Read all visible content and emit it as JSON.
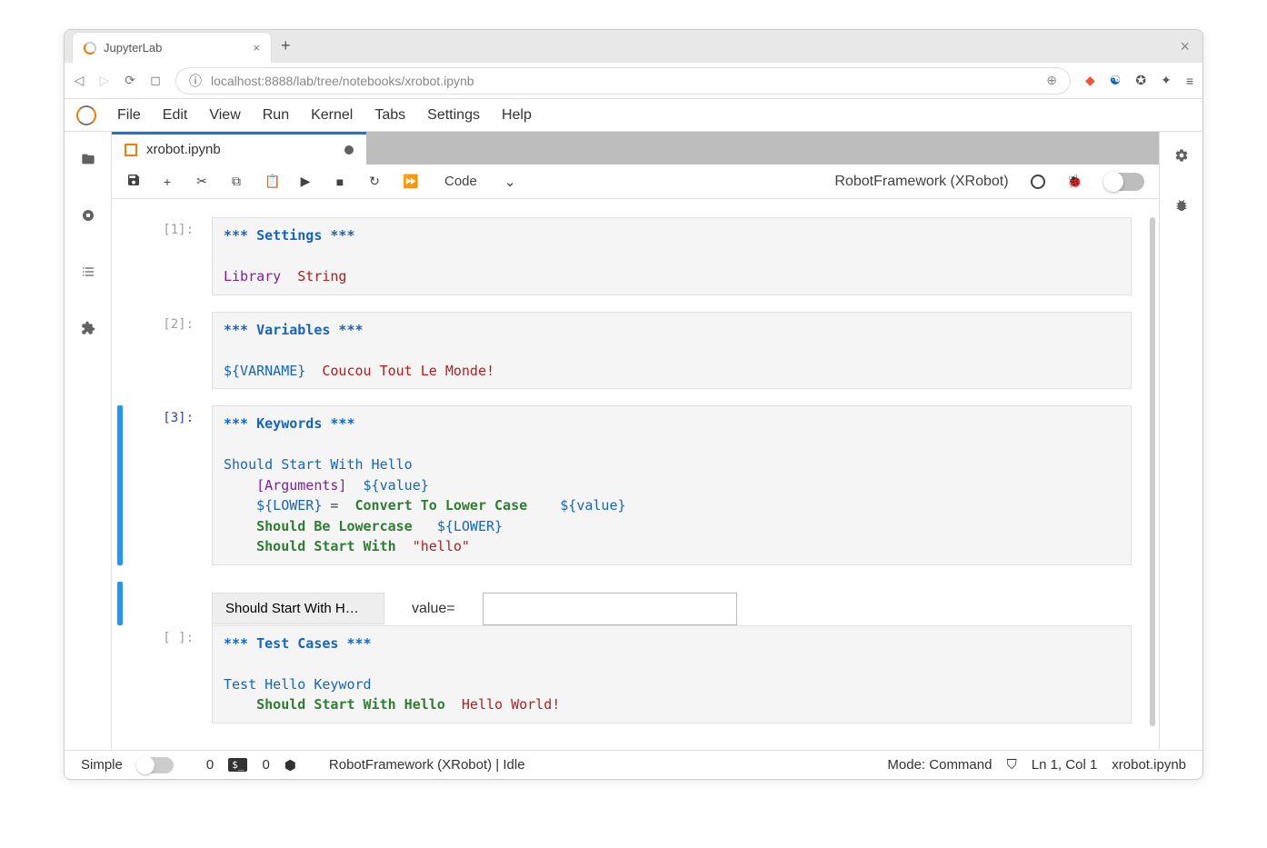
{
  "browser": {
    "tab_title": "JupyterLab",
    "url_host": "localhost:",
    "url_port": "8888",
    "url_path": "/lab/tree/notebooks/xrobot.ipynb"
  },
  "menu": [
    "File",
    "Edit",
    "View",
    "Run",
    "Kernel",
    "Tabs",
    "Settings",
    "Help"
  ],
  "doc_tab": {
    "title": "xrobot.ipynb"
  },
  "toolbar": {
    "celltype": "Code",
    "kernel": "RobotFramework (XRobot)"
  },
  "cells": [
    {
      "prompt": "[1]:",
      "selected": false,
      "lines": [
        [
          {
            "cls": "tok-section",
            "t": "*** "
          },
          {
            "cls": "tok-section",
            "t": "Settings"
          },
          {
            "cls": "tok-section",
            "t": " ***"
          }
        ],
        [
          {
            "cls": "",
            "t": ""
          }
        ],
        [
          {
            "cls": "tok-setting",
            "t": "Library"
          },
          {
            "cls": "",
            "t": "  "
          },
          {
            "cls": "tok-string",
            "t": "String"
          }
        ]
      ]
    },
    {
      "prompt": "[2]:",
      "selected": false,
      "lines": [
        [
          {
            "cls": "tok-section",
            "t": "*** "
          },
          {
            "cls": "tok-section",
            "t": "Variables"
          },
          {
            "cls": "tok-section",
            "t": " ***"
          }
        ],
        [
          {
            "cls": "",
            "t": ""
          }
        ],
        [
          {
            "cls": "tok-var",
            "t": "${VARNAME}"
          },
          {
            "cls": "",
            "t": "  "
          },
          {
            "cls": "tok-string",
            "t": "Coucou Tout Le Monde!"
          }
        ]
      ]
    },
    {
      "prompt": "[3]:",
      "selected": true,
      "lines": [
        [
          {
            "cls": "tok-section",
            "t": "*** "
          },
          {
            "cls": "tok-section",
            "t": "Keywords"
          },
          {
            "cls": "tok-section",
            "t": " ***"
          }
        ],
        [
          {
            "cls": "",
            "t": ""
          }
        ],
        [
          {
            "cls": "tok-keyword-def",
            "t": "Should Start With Hello"
          }
        ],
        [
          {
            "cls": "",
            "t": "    "
          },
          {
            "cls": "tok-arg",
            "t": "[Arguments]"
          },
          {
            "cls": "",
            "t": "  "
          },
          {
            "cls": "tok-var",
            "t": "${value}"
          }
        ],
        [
          {
            "cls": "",
            "t": "    "
          },
          {
            "cls": "tok-var",
            "t": "${LOWER}"
          },
          {
            "cls": "tok-assign",
            "t": " =  "
          },
          {
            "cls": "tok-kw-call",
            "t": "Convert To Lower Case"
          },
          {
            "cls": "",
            "t": "    "
          },
          {
            "cls": "tok-var",
            "t": "${value}"
          }
        ],
        [
          {
            "cls": "",
            "t": "    "
          },
          {
            "cls": "tok-kw-call",
            "t": "Should Be Lowercase"
          },
          {
            "cls": "",
            "t": "   "
          },
          {
            "cls": "tok-var",
            "t": "${LOWER}"
          }
        ],
        [
          {
            "cls": "",
            "t": "    "
          },
          {
            "cls": "tok-kw-call",
            "t": "Should Start With"
          },
          {
            "cls": "",
            "t": "  "
          },
          {
            "cls": "tok-quoted",
            "t": "\"hello\""
          }
        ]
      ],
      "output": {
        "button": "Should Start With H…",
        "label": "value="
      }
    },
    {
      "prompt": "[ ]:",
      "selected": false,
      "lines": [
        [
          {
            "cls": "tok-section",
            "t": "*** "
          },
          {
            "cls": "tok-section",
            "t": "Test Cases"
          },
          {
            "cls": "tok-section",
            "t": " ***"
          }
        ],
        [
          {
            "cls": "",
            "t": ""
          }
        ],
        [
          {
            "cls": "tok-keyword-def",
            "t": "Test Hello Keyword"
          }
        ],
        [
          {
            "cls": "",
            "t": "    "
          },
          {
            "cls": "tok-kw-call",
            "t": "Should Start With Hello"
          },
          {
            "cls": "",
            "t": "  "
          },
          {
            "cls": "tok-string",
            "t": "Hello World!"
          }
        ]
      ]
    }
  ],
  "status": {
    "simple": "Simple",
    "count1": "0",
    "count2": "0",
    "kernel_status": "RobotFramework (XRobot) | Idle",
    "mode": "Mode: Command",
    "lncol": "Ln 1, Col 1",
    "filename": "xrobot.ipynb"
  }
}
